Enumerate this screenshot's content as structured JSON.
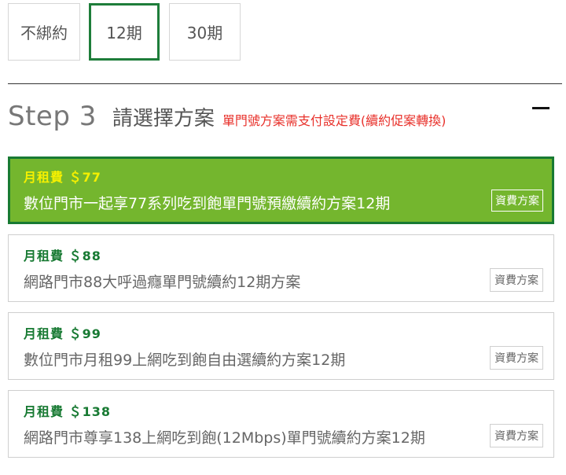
{
  "contract_tabs": [
    {
      "label": "不綁約",
      "selected": false
    },
    {
      "label": "12期",
      "selected": true
    },
    {
      "label": "30期",
      "selected": false
    }
  ],
  "step": {
    "label": "Step 3",
    "title": "請選擇方案",
    "note": "單門號方案需支付設定費(續約促案轉換)",
    "collapse_icon": "minus-icon"
  },
  "plans": [
    {
      "fee": "月租費 ＄77",
      "name": "數位門市一起享77系列吃到飽單門號預繳續約方案12期",
      "tariff_label": "資費方案",
      "selected": true
    },
    {
      "fee": "月租費 ＄88",
      "name": "網路門市88大呼過癮單門號續約12期方案",
      "tariff_label": "資費方案",
      "selected": false
    },
    {
      "fee": "月租費 ＄99",
      "name": "數位門市月租99上網吃到飽自由選續約方案12期",
      "tariff_label": "資費方案",
      "selected": false
    },
    {
      "fee": "月租費 ＄138",
      "name": "網路門市尊享138上網吃到飽(12Mbps)單門號續約方案12期",
      "tariff_label": "資費方案",
      "selected": false
    }
  ],
  "colors": {
    "accent_green": "#187a33",
    "selected_bg": "#74b62e",
    "selected_fee": "#f5f000",
    "note_red": "#e8302a"
  }
}
